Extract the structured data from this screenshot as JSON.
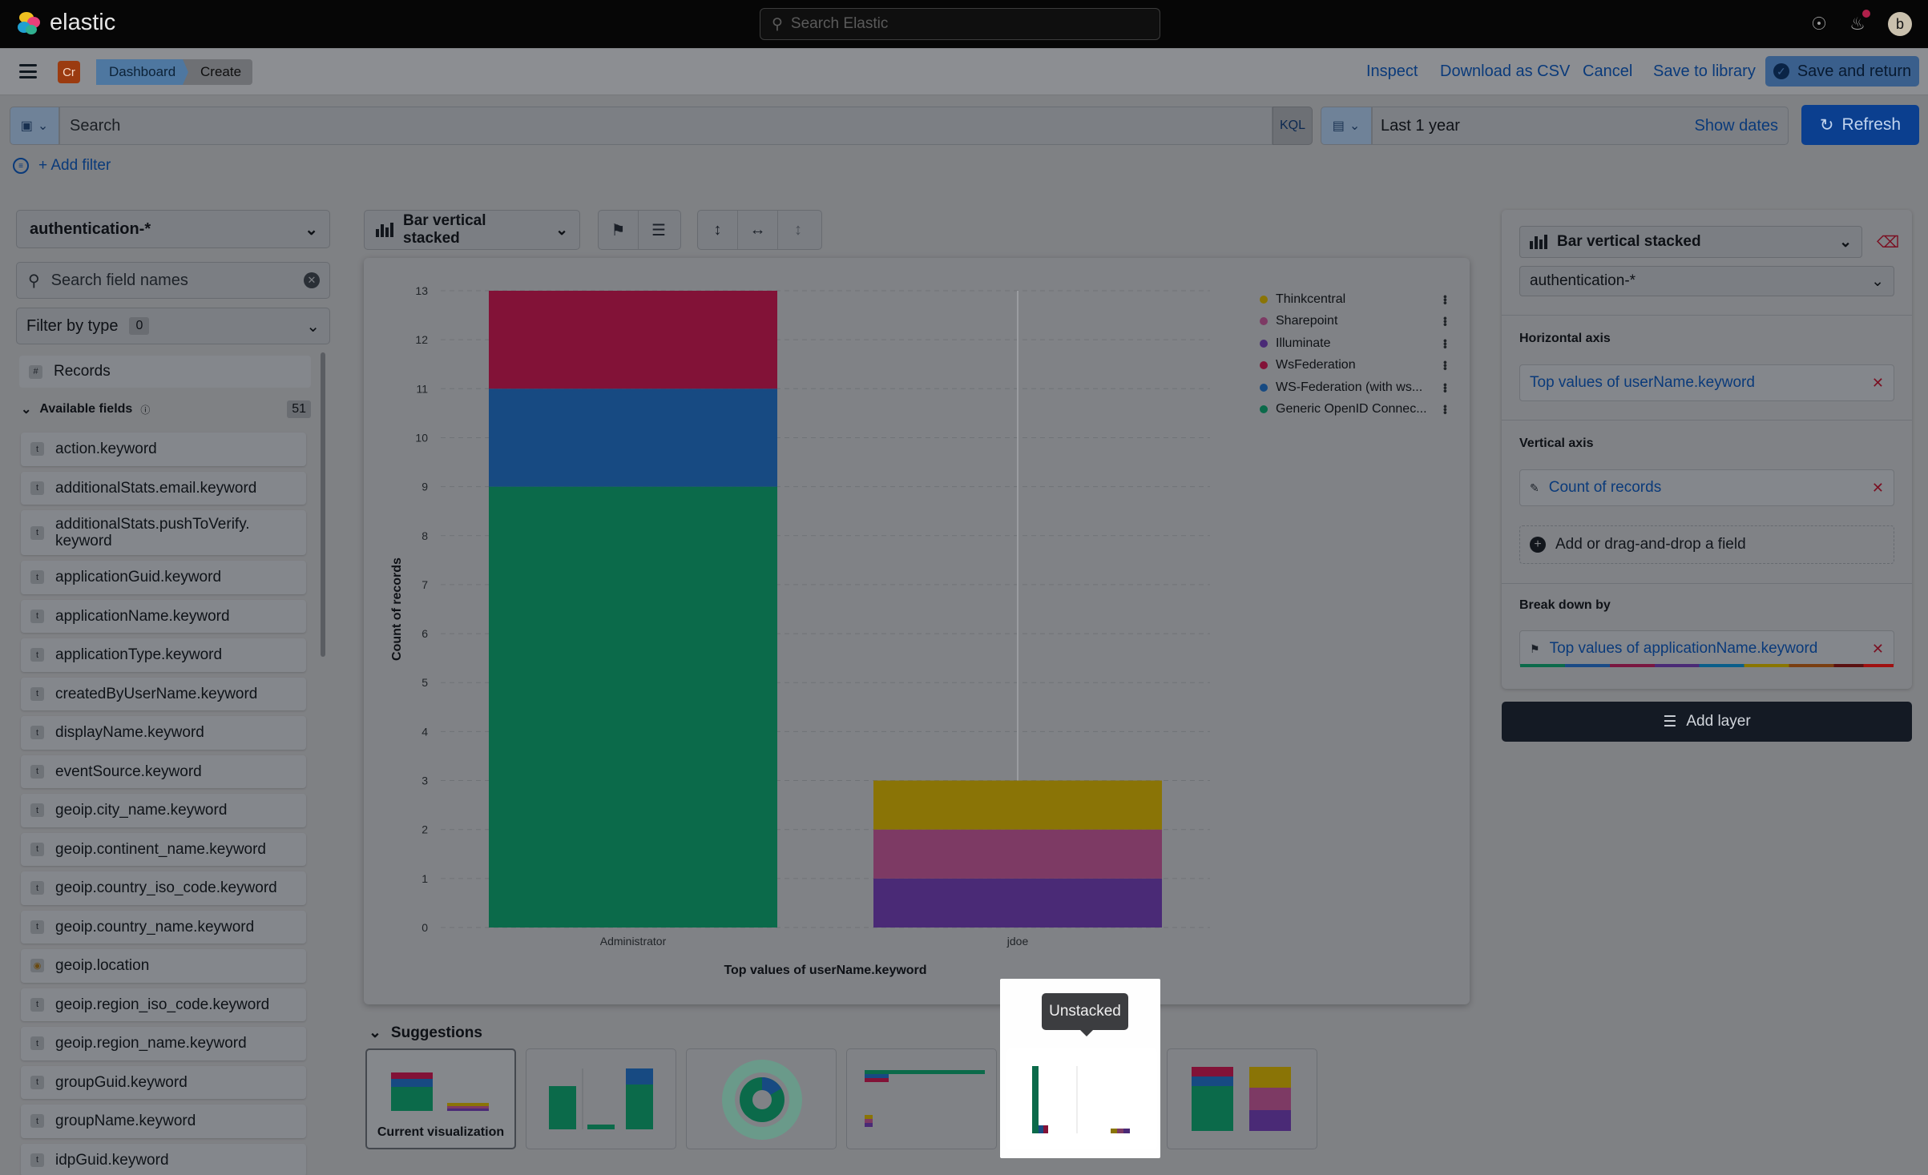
{
  "header": {
    "brand": "elastic",
    "search_placeholder": "Search Elastic",
    "avatar_initial": "b"
  },
  "nav": {
    "space_badge": "Cr",
    "breadcrumbs": [
      "Dashboard",
      "Create"
    ],
    "actions": {
      "inspect": "Inspect",
      "download_csv": "Download as CSV",
      "cancel": "Cancel",
      "save_library": "Save to library",
      "save_return": "Save and return"
    }
  },
  "query": {
    "search_placeholder": "Search",
    "language": "KQL",
    "time_range": "Last 1 year",
    "show_dates": "Show dates",
    "refresh": "Refresh",
    "add_filter": "+ Add filter"
  },
  "fields_panel": {
    "data_view": "authentication-*",
    "field_search_placeholder": "Search field names",
    "filter_by_type": "Filter by type",
    "filter_count": "0",
    "records": "Records",
    "available_fields_label": "Available fields",
    "available_fields_count": "51",
    "fields": [
      {
        "type": "t",
        "name": "action.keyword"
      },
      {
        "type": "t",
        "name": "additionalStats.email.keyword"
      },
      {
        "type": "t",
        "name": "additionalStats.pushToVerify.\nkeyword"
      },
      {
        "type": "t",
        "name": "applicationGuid.keyword"
      },
      {
        "type": "t",
        "name": "applicationName.keyword"
      },
      {
        "type": "t",
        "name": "applicationType.keyword"
      },
      {
        "type": "t",
        "name": "createdByUserName.keyword"
      },
      {
        "type": "t",
        "name": "displayName.keyword"
      },
      {
        "type": "t",
        "name": "eventSource.keyword"
      },
      {
        "type": "t",
        "name": "geoip.city_name.keyword"
      },
      {
        "type": "t",
        "name": "geoip.continent_name.keyword"
      },
      {
        "type": "t",
        "name": "geoip.country_iso_code.keyword"
      },
      {
        "type": "t",
        "name": "geoip.country_name.keyword"
      },
      {
        "type": "geo",
        "name": "geoip.location"
      },
      {
        "type": "t",
        "name": "geoip.region_iso_code.keyword"
      },
      {
        "type": "t",
        "name": "geoip.region_name.keyword"
      },
      {
        "type": "t",
        "name": "groupGuid.keyword"
      },
      {
        "type": "t",
        "name": "groupName.keyword"
      },
      {
        "type": "t",
        "name": "idpGuid.keyword"
      }
    ]
  },
  "workspace": {
    "vis_type": "Bar vertical stacked",
    "suggestions_label": "Suggestions",
    "current_visualization": "Current visualization",
    "tooltip": "Unstacked"
  },
  "chart_data": {
    "type": "bar",
    "stacked": true,
    "categories": [
      "Administrator",
      "jdoe"
    ],
    "series": [
      {
        "name": "Generic OpenID Connec...",
        "color": "#0b6a4a",
        "values": [
          9,
          0
        ]
      },
      {
        "name": "WS-Federation (with ws...",
        "color": "#174a82",
        "values": [
          2,
          0
        ]
      },
      {
        "name": "WsFederation",
        "color": "#821237",
        "values": [
          2,
          0
        ]
      },
      {
        "name": "Illuminate",
        "color": "#4a2a76",
        "values": [
          0,
          1
        ]
      },
      {
        "name": "Sharepoint",
        "color": "#7d3a64",
        "values": [
          0,
          1
        ]
      },
      {
        "name": "Thinkcentral",
        "color": "#8a7406",
        "values": [
          0,
          1
        ]
      }
    ],
    "legend_order": [
      "Thinkcentral",
      "Sharepoint",
      "Illuminate",
      "WsFederation",
      "WS-Federation (with ws...",
      "Generic OpenID Connec..."
    ],
    "legend_colors": [
      "#8a7406",
      "#7d3a64",
      "#4a2a76",
      "#821237",
      "#174a82",
      "#0b6a4a"
    ],
    "xlabel": "Top values of userName.keyword",
    "ylabel": "Count of records",
    "ylim": [
      0,
      13
    ],
    "yticks": [
      0,
      1,
      2,
      3,
      4,
      5,
      6,
      7,
      8,
      9,
      10,
      11,
      12,
      13
    ],
    "grid": true,
    "legend_position": "top-right"
  },
  "config_panel": {
    "vis_type": "Bar vertical stacked",
    "data_view": "authentication-*",
    "horizontal_axis_label": "Horizontal axis",
    "horizontal_axis_value": "Top values of userName.keyword",
    "vertical_axis_label": "Vertical axis",
    "vertical_axis_value": "Count of records",
    "add_field": "Add or drag-and-drop a field",
    "breakdown_label": "Break down by",
    "breakdown_value": "Top values of applicationName.keyword",
    "add_layer": "Add layer"
  }
}
